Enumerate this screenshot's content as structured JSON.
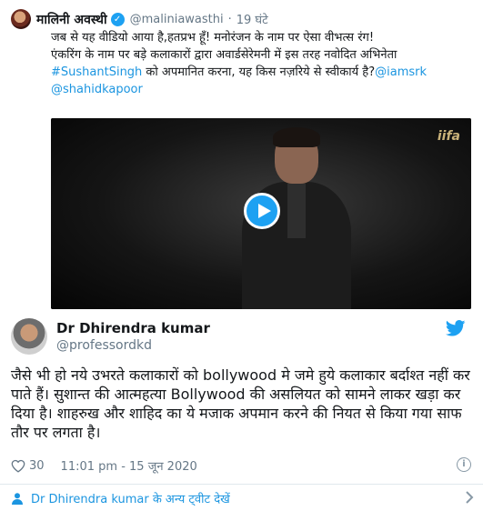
{
  "quoted": {
    "author_name": "मालिनी अवस्थी",
    "verified_symbol": "✓",
    "handle": "@maliniawasthi",
    "dot": "·",
    "time": "19 घंटे",
    "text_line1": "जब से यह वीडियो आया है,हतप्रभ हूँ! मनोरंजन के नाम पर ऐसा वीभत्स रंग!",
    "text_line2": "एंकरिंग के नाम पर बड़े कलाकारों द्वारा अवार्डसेरेमनी में इस तरह नवोदित अभिनेता",
    "hashtag": "#SushantSingh",
    "text_line3_rest": " को अपमानित करना, यह किस नज़रिये से स्वीकार्य है?",
    "mention1": "@iamsrk",
    "mention2": "@shahidkapoor",
    "media_watermark": "iifa"
  },
  "tweet": {
    "author_name": "Dr Dhirendra kumar",
    "handle": "@professordkd",
    "text": "जैसे भी हो नये उभरते कलाकारों को bollywood मे जमे हुये कलाकार बर्दाश्त नहीं कर पाते हैं। सुशान्त की आत्महत्या Bollywood की असलियत को सामने लाकर खड़ा कर दिया है। शाहरुख और शाहिद का ये मजाक अपमान करने की नियत से किया गया साफ तौर पर लगता है।",
    "likes": "30",
    "timestamp": "11:01 pm - 15 जून 2020",
    "info_symbol": "i"
  },
  "footer": {
    "more_tweets_label": "Dr Dhirendra kumar के अन्य ट्वीट देखें"
  },
  "colors": {
    "link": "#1b95e0",
    "verified": "#1da1f2",
    "secondary_text": "#657786"
  },
  "icons": [
    "verified-icon",
    "play-icon",
    "twitter-icon",
    "heart-icon",
    "info-icon",
    "person-icon",
    "chevron-right-icon"
  ]
}
